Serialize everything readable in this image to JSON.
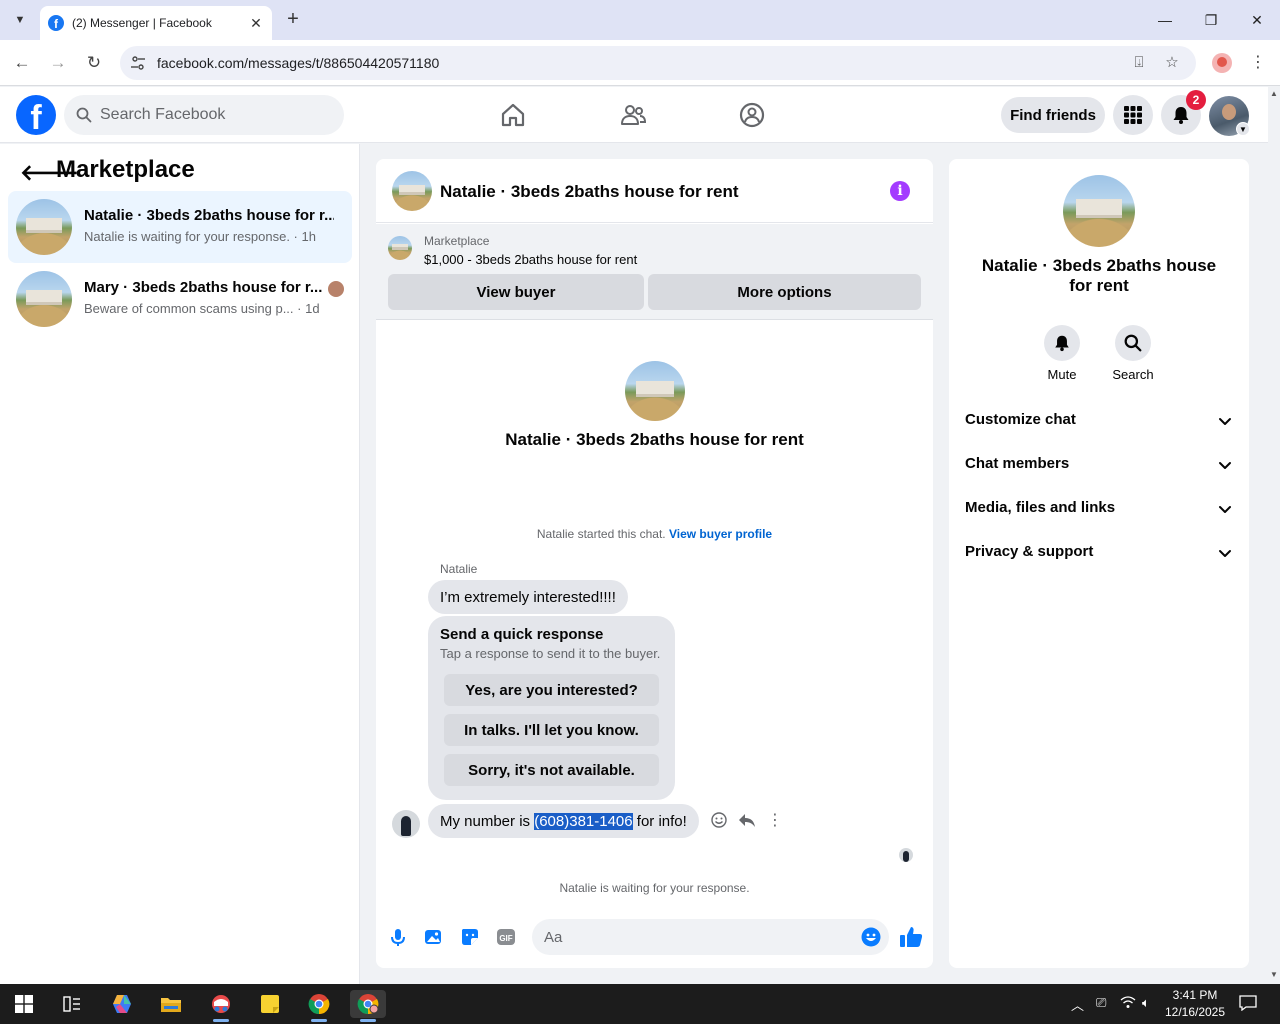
{
  "browser": {
    "tab_title": "(2) Messenger | Facebook",
    "url": "facebook.com/messages/t/886504420571180"
  },
  "fb_header": {
    "search_placeholder": "Search Facebook",
    "find_friends_label": "Find friends",
    "notification_count": "2"
  },
  "left_panel": {
    "title": "Marketplace",
    "conversations": [
      {
        "name": "Natalie · 3beds 2baths house for r...",
        "preview": "Natalie is waiting for your response.",
        "time": " · 1h"
      },
      {
        "name": "Mary · 3beds 2baths house for r...",
        "preview": "Beware of common scams using p...",
        "time": " · 1d"
      }
    ]
  },
  "chat": {
    "title": "Natalie · 3beds 2baths house for rent",
    "listing_label": "Marketplace",
    "listing_price_title": "$1,000 - 3beds 2baths house for rent",
    "view_buyer_label": "View buyer",
    "more_options_label": "More options",
    "center_name": "Natalie · 3beds 2baths house for rent",
    "started_text": "Natalie started this chat.",
    "view_buyer_profile_label": "View buyer profile",
    "sender_name": "Natalie",
    "message_1": "I’m extremely interested!!!!",
    "quick_title": "Send a quick response",
    "quick_sub": "Tap a response to send it to the buyer.",
    "quick_responses": [
      "Yes, are you interested?",
      "In talks. I'll let you know.",
      "Sorry, it's not available."
    ],
    "message_2_prefix": "My number is ",
    "message_2_selected": "(608)381-1406",
    "message_2_suffix": " for info!",
    "waiting_text": "Natalie is waiting for your response.",
    "composer_placeholder": "Aa"
  },
  "right_panel": {
    "name": "Natalie · 3beds 2baths house for rent",
    "mute_label": "Mute",
    "search_label": "Search",
    "sections": [
      "Customize chat",
      "Chat members",
      "Media, files and links",
      "Privacy & support"
    ]
  },
  "taskbar": {
    "time": "3:41 PM",
    "date": "12/16/2025"
  },
  "colors": {
    "fb_blue": "#0866ff",
    "messenger_blue": "#0a7cff",
    "active_conv_bg": "#ebf5ff",
    "info_purple": "#a33bff",
    "badge_red": "#e41e3f"
  }
}
